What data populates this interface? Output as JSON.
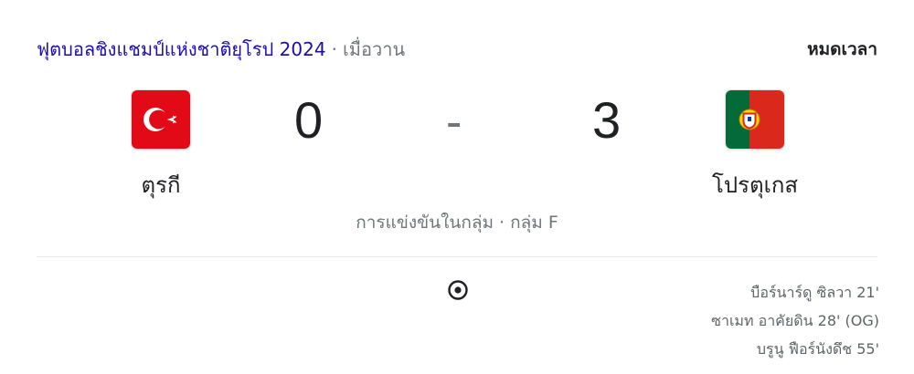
{
  "header": {
    "competition": "ฟุตบอลชิงแชมป์แห่งชาติยุโรป 2024",
    "separator": "·",
    "when": "เมื่อวาน",
    "status": "หมดเวลา"
  },
  "match": {
    "home": {
      "name": "ตุรกี",
      "score": "0",
      "flag_icon": "turkey-flag-icon"
    },
    "away": {
      "name": "โปรตุเกส",
      "score": "3",
      "flag_icon": "portugal-flag-icon"
    },
    "score_separator": "-",
    "stage": "การแข่งขันในกลุ่ม · กลุ่ม F"
  },
  "goals": {
    "icon": "soccer-ball-icon",
    "away_scorers": [
      "บือร์นาร์ดู ซิลวา 21'",
      "ซาเมท อาคัยดิน 28' (OG)",
      "บรูนู ฟือร์นังดึช 55'"
    ]
  },
  "colors": {
    "link": "#1a0dab",
    "muted": "#70757a",
    "turkey_red": "#e30a17",
    "portugal_green": "#046a38",
    "portugal_red": "#da291c"
  }
}
